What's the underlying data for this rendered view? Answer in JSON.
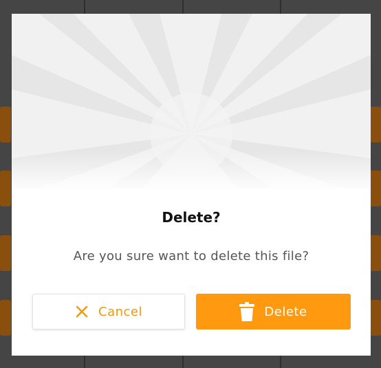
{
  "dialog": {
    "title": "Delete?",
    "message": "Are you sure want to delete this file?",
    "cancel_label": "Cancel",
    "cancel_icon": "close-x-icon",
    "delete_label": "Delete",
    "delete_icon": "trash-icon"
  },
  "colors": {
    "accent": "#ff9a10",
    "cancel_text": "#f4970c",
    "title_text": "#111111",
    "message_text": "#555555"
  }
}
